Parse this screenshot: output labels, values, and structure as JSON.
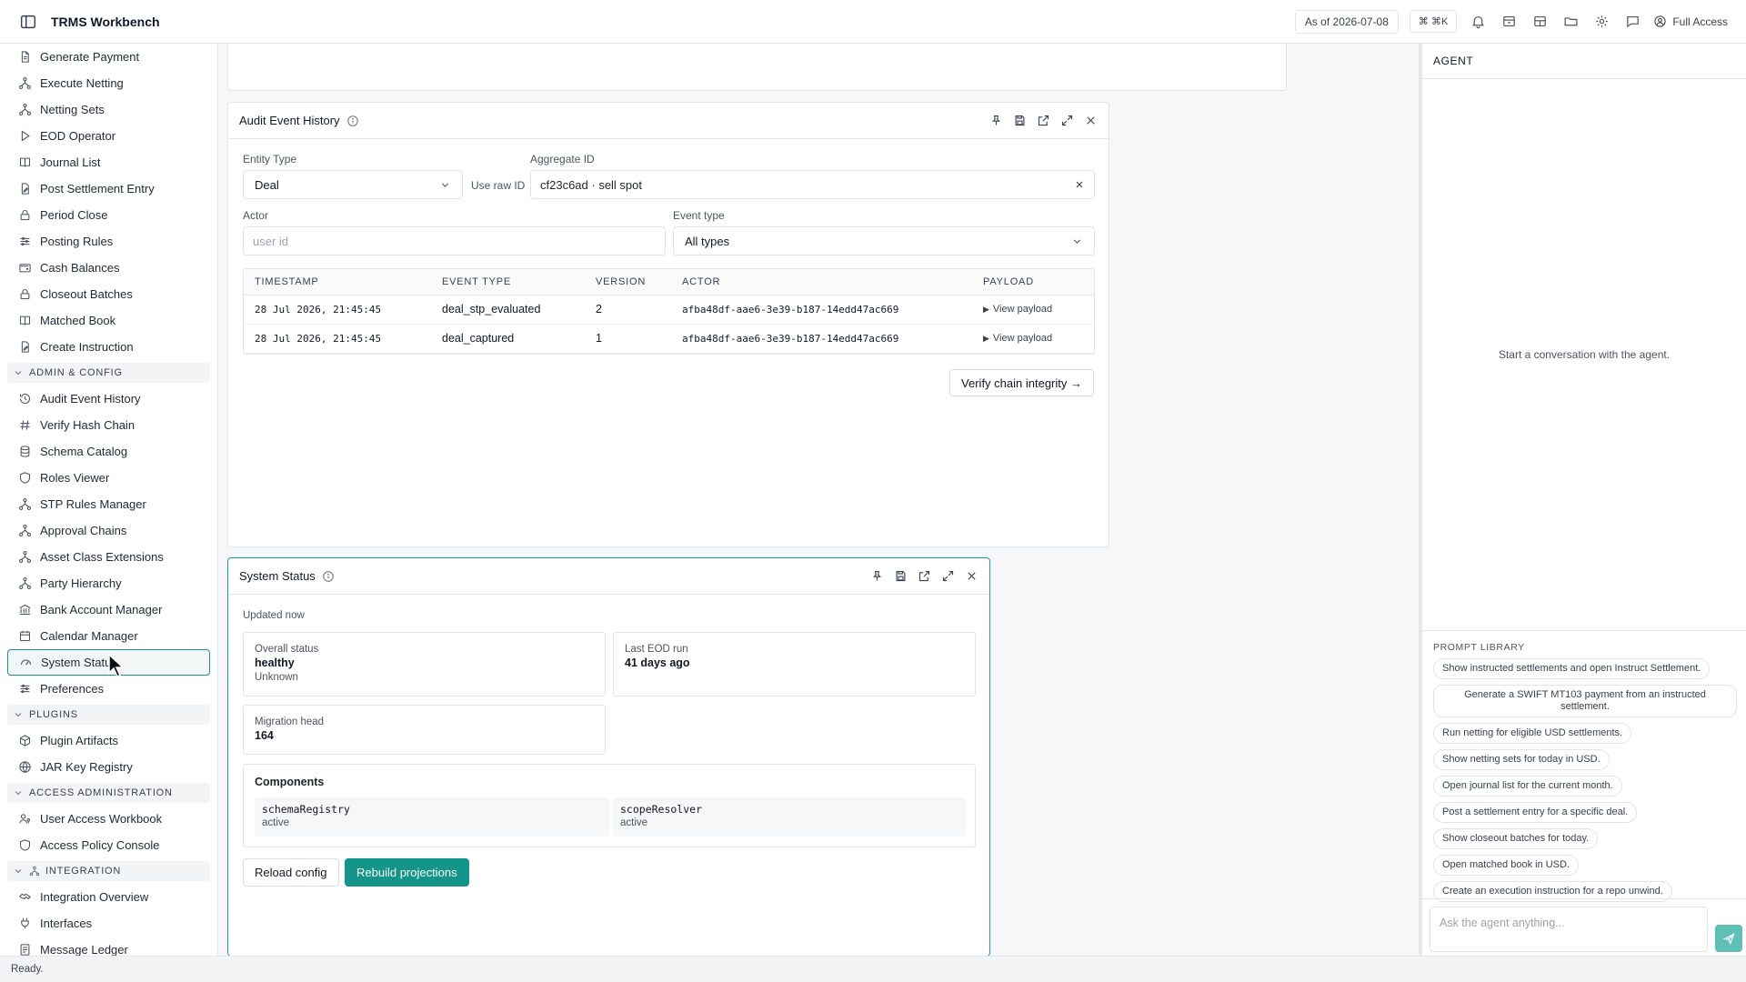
{
  "topbar": {
    "app_title": "TRMS Workbench",
    "as_of": "As of 2026-07-08",
    "command_shortcut": "⌘ ⌘K",
    "access_label": "Full Access"
  },
  "sidebar": {
    "items_top": [
      {
        "label": "Generate Payment",
        "icon": "document-icon"
      },
      {
        "label": "Execute Netting",
        "icon": "network-icon"
      },
      {
        "label": "Netting Sets",
        "icon": "network-icon"
      },
      {
        "label": "EOD Operator",
        "icon": "play-icon"
      },
      {
        "label": "Journal List",
        "icon": "book-icon"
      },
      {
        "label": "Post Settlement Entry",
        "icon": "document-edit-icon"
      },
      {
        "label": "Period Close",
        "icon": "lock-icon"
      },
      {
        "label": "Posting Rules",
        "icon": "sliders-icon"
      },
      {
        "label": "Cash Balances",
        "icon": "wallet-icon"
      },
      {
        "label": "Closeout Batches",
        "icon": "lock-icon"
      },
      {
        "label": "Matched Book",
        "icon": "book-icon"
      },
      {
        "label": "Create Instruction",
        "icon": "document-edit-icon"
      }
    ],
    "section_admin": "ADMIN & CONFIG",
    "items_admin": [
      {
        "label": "Audit Event History",
        "icon": "history-icon"
      },
      {
        "label": "Verify Hash Chain",
        "icon": "hash-icon"
      },
      {
        "label": "Schema Catalog",
        "icon": "database-icon"
      },
      {
        "label": "Roles Viewer",
        "icon": "shield-icon"
      },
      {
        "label": "STP Rules Manager",
        "icon": "network-icon"
      },
      {
        "label": "Approval Chains",
        "icon": "network-icon"
      },
      {
        "label": "Asset Class Extensions",
        "icon": "network-icon"
      },
      {
        "label": "Party Hierarchy",
        "icon": "network-icon"
      },
      {
        "label": "Bank Account Manager",
        "icon": "bank-icon"
      },
      {
        "label": "Calendar Manager",
        "icon": "calendar-icon"
      },
      {
        "label": "System Status",
        "icon": "gauge-icon"
      },
      {
        "label": "Preferences",
        "icon": "sliders-icon"
      }
    ],
    "section_plugins": "PLUGINS",
    "items_plugins": [
      {
        "label": "Plugin Artifacts",
        "icon": "package-icon"
      },
      {
        "label": "JAR Key Registry",
        "icon": "globe-icon"
      }
    ],
    "section_access": "ACCESS ADMINISTRATION",
    "items_access": [
      {
        "label": "User Access Workbook",
        "icon": "user-key-icon"
      },
      {
        "label": "Access Policy Console",
        "icon": "shield-icon"
      }
    ],
    "section_integration": "INTEGRATION",
    "items_integration": [
      {
        "label": "Integration Overview",
        "icon": "handshake-icon"
      },
      {
        "label": "Interfaces",
        "icon": "plug-icon"
      },
      {
        "label": "Message Ledger",
        "icon": "ledger-icon"
      }
    ]
  },
  "audit_panel": {
    "title": "Audit Event History",
    "entity_type_label": "Entity Type",
    "entity_type_value": "Deal",
    "use_raw_id_label": "Use raw ID",
    "aggregate_id_label": "Aggregate ID",
    "aggregate_id_value": "cf23c6ad · sell spot",
    "actor_label": "Actor",
    "actor_placeholder": "user id",
    "event_type_label": "Event type",
    "event_type_value": "All types",
    "columns": [
      "TIMESTAMP",
      "EVENT TYPE",
      "VERSION",
      "ACTOR",
      "PAYLOAD"
    ],
    "rows": [
      {
        "timestamp": "28 Jul 2026, 21:45:45",
        "event_type": "deal_stp_evaluated",
        "version": "2",
        "actor": "afba48df-aae6-3e39-b187-14edd47ac669",
        "payload": "View payload"
      },
      {
        "timestamp": "28 Jul 2026, 21:45:45",
        "event_type": "deal_captured",
        "version": "1",
        "actor": "afba48df-aae6-3e39-b187-14edd47ac669",
        "payload": "View payload"
      }
    ],
    "verify_button": "Verify chain integrity →"
  },
  "status_panel": {
    "title": "System Status",
    "updated": "Updated now",
    "overall_label": "Overall status",
    "overall_value": "healthy",
    "overall_sub": "Unknown",
    "eod_label": "Last EOD run",
    "eod_value": "41 days ago",
    "migration_label": "Migration head",
    "migration_value": "164",
    "components_title": "Components",
    "components": [
      {
        "name": "schemaRegistry",
        "state": "active"
      },
      {
        "name": "scopeResolver",
        "state": "active"
      }
    ],
    "reload_button": "Reload config",
    "rebuild_button": "Rebuild projections"
  },
  "agent": {
    "title": "AGENT",
    "empty_text": "Start a conversation with the agent.",
    "prompt_library_title": "PROMPT LIBRARY",
    "prompts": [
      "Show instructed settlements and open Instruct Settlement.",
      "Generate a SWIFT MT103 payment from an instructed settlement.",
      "Run netting for eligible USD settlements.",
      "Show netting sets for today in USD.",
      "Open journal list for the current month.",
      "Post a settlement entry for a specific deal.",
      "Show closeout batches for today.",
      "Open matched book in USD.",
      "Create an execution instruction for a repo unwind."
    ],
    "input_placeholder": "Ask the agent anything..."
  },
  "statusbar": {
    "text": "Ready."
  },
  "colors": {
    "accent": "#14958a",
    "accent_light": "#5fc0b5"
  }
}
